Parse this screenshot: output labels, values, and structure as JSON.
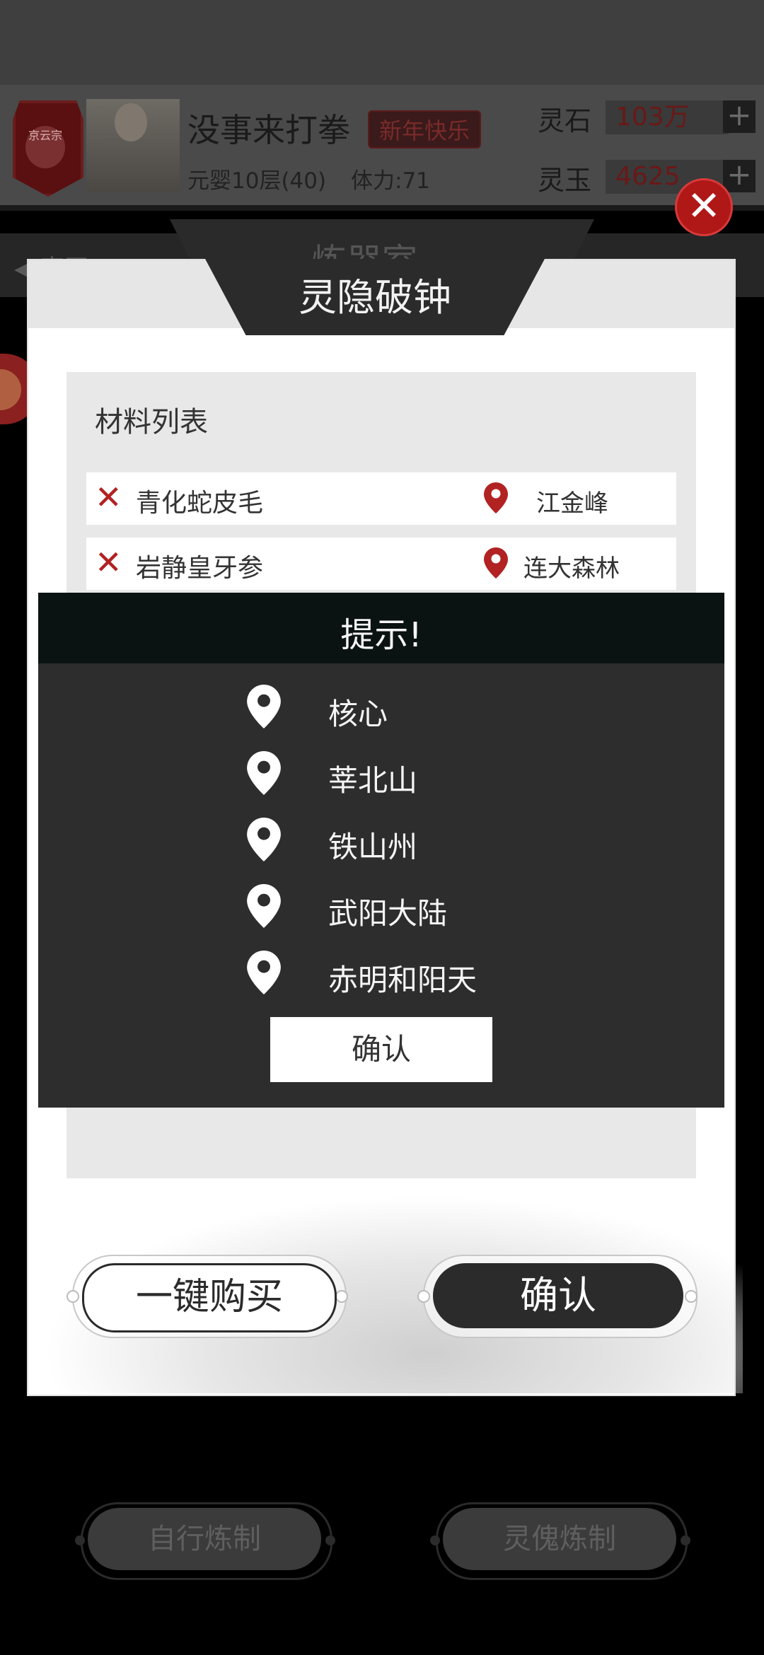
{
  "header": {
    "sect_badge": "京云宗",
    "player_name": "没事来打拳",
    "badge": "新年快乐",
    "level": "元婴10层(40)",
    "stamina": "体力:71",
    "resources": [
      {
        "label": "灵石",
        "value": "103万"
      },
      {
        "label": "灵玉",
        "value": "4625"
      }
    ],
    "plus": "+"
  },
  "nav": {
    "back_label": "◀ 离开",
    "title": "炼器室"
  },
  "modal": {
    "title": "灵隐破钟",
    "close": "✕",
    "materials_title": "材料列表",
    "materials": [
      {
        "status": "✕",
        "name": "青化蛇皮毛",
        "location": "江金峰"
      },
      {
        "status": "✕",
        "name": "岩静皇牙参",
        "location": "连大森林"
      }
    ],
    "buy_button": "一键购买",
    "confirm_button": "确认"
  },
  "hint": {
    "title": "提示!",
    "locations": [
      "核心",
      "莘北山",
      "铁山州",
      "武阳大陆",
      "赤明和阳天"
    ],
    "confirm": "确认"
  },
  "bottom": {
    "self_refine": "自行炼制",
    "puppet_refine": "灵傀炼制"
  },
  "colors": {
    "accent_red": "#b22222",
    "dark": "#2b2b2b",
    "hint_header": "#0b1212"
  },
  "icons": {
    "location": "map-pin-icon",
    "remove": "close-icon"
  }
}
